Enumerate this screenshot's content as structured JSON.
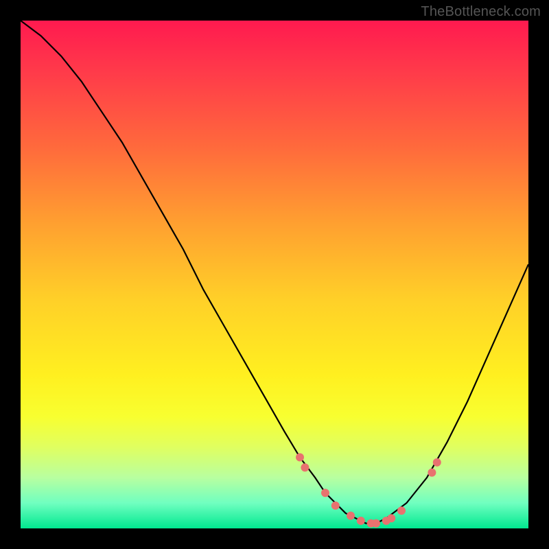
{
  "attribution": "TheBottleneck.com",
  "colors": {
    "gradient_top": "#ff1a4f",
    "gradient_bottom": "#00e890",
    "curve": "#000000",
    "markers": "#e8726f",
    "frame_bg": "#000000"
  },
  "chart_data": {
    "type": "line",
    "title": "",
    "xlabel": "",
    "ylabel": "",
    "xlim": [
      0,
      100
    ],
    "ylim": [
      0,
      100
    ],
    "series": [
      {
        "name": "curve",
        "x": [
          0,
          4,
          8,
          12,
          16,
          20,
          24,
          28,
          32,
          36,
          40,
          44,
          48,
          52,
          55,
          58,
          60,
          62,
          64,
          66,
          68,
          70,
          72,
          76,
          80,
          84,
          88,
          92,
          96,
          100
        ],
        "y": [
          100,
          97,
          93,
          88,
          82,
          76,
          69,
          62,
          55,
          47,
          40,
          33,
          26,
          19,
          14,
          10,
          7,
          5,
          3,
          2,
          1,
          1,
          2,
          5,
          10,
          17,
          25,
          34,
          43,
          52
        ]
      }
    ],
    "markers": {
      "name": "highlight-points",
      "x": [
        55,
        56,
        60,
        62,
        65,
        67,
        69,
        70,
        72,
        73,
        75,
        81,
        82
      ],
      "y": [
        14,
        12,
        7,
        4.5,
        2.5,
        1.5,
        1,
        1,
        1.5,
        2,
        3.5,
        11,
        13
      ]
    }
  }
}
